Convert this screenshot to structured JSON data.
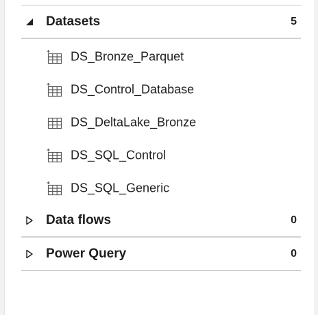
{
  "resources": {
    "datasets": {
      "title": "Datasets",
      "count": "5",
      "items": [
        {
          "label": "DS_Bronze_Parquet",
          "icon": "dataset-table-new-icon"
        },
        {
          "label": "DS_Control_Database",
          "icon": "dataset-table-new-icon"
        },
        {
          "label": "DS_DeltaLake_Bronze",
          "icon": "dataset-table-icon"
        },
        {
          "label": "DS_SQL_Control",
          "icon": "dataset-table-new-icon"
        },
        {
          "label": "DS_SQL_Generic",
          "icon": "dataset-table-new-icon"
        }
      ]
    },
    "dataflows": {
      "title": "Data flows",
      "count": "0"
    },
    "powerquery": {
      "title": "Power Query",
      "count": "0"
    }
  },
  "colors": {
    "text": "#1f1f1f",
    "icon": "#5a5a5a",
    "divider": "#d2d2d2",
    "panel_background": "#ffffff",
    "page_background": "#f2f2f2"
  }
}
